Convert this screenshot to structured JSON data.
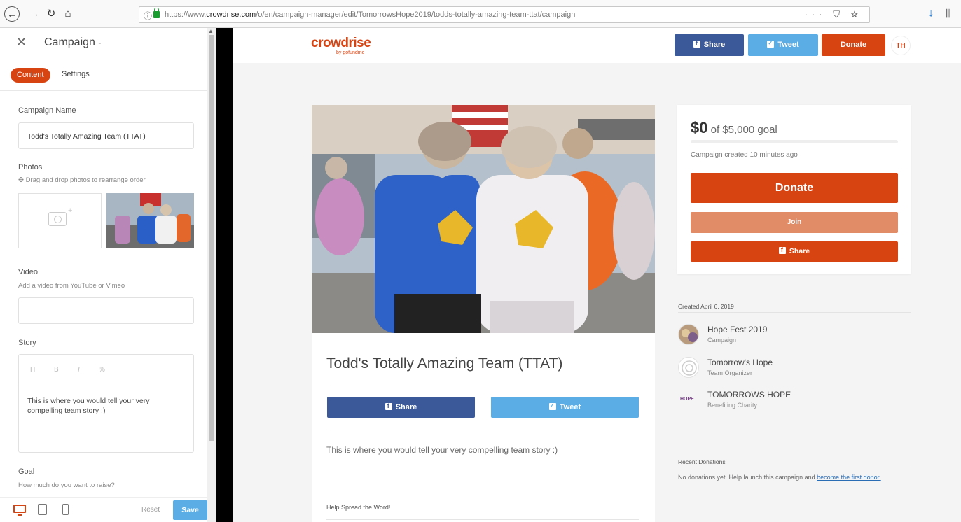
{
  "browser": {
    "url_prefix": "https://www.",
    "url_domain": "crowdrise.com",
    "url_path": "/o/en/campaign-manager/edit/TomorrowsHope2019/todds-totally-amazing-team-ttat/campaign",
    "more_label": "···"
  },
  "editor": {
    "title": "Campaign",
    "tabs": {
      "content": "Content",
      "settings": "Settings"
    },
    "campaign_name_label": "Campaign Name",
    "campaign_name_value": "Todd's Totally Amazing Team (TTAT)",
    "photos_label": "Photos",
    "photos_hint": "Drag and drop photos to rearrange order",
    "video_label": "Video",
    "video_hint": "Add a video from YouTube or Vimeo",
    "story_label": "Story",
    "story_tools": [
      "H",
      "B",
      "I",
      "%"
    ],
    "story_text": "This is where you would tell your very compelling team story :)",
    "goal_label": "Goal",
    "goal_hint": "How much do you want to raise?",
    "reset_label": "Reset",
    "save_label": "Save"
  },
  "site": {
    "logo": "crowdrise",
    "logo_sub": "by gofundme",
    "header_buttons": {
      "share": "Share",
      "tweet": "Tweet",
      "donate": "Donate"
    },
    "avatar_initials": "TH",
    "campaign_title": "Todd's Totally Amazing Team (TTAT)",
    "card_share": "Share",
    "card_tweet": "Tweet",
    "story_text": "This is where you would tell your very compelling team story :)",
    "spread_label": "Help Spread the Word!"
  },
  "donation": {
    "raised": "$0",
    "goal_text": "of $5,000 goal",
    "progress": 0,
    "created_ago": "Campaign created 10 minutes ago",
    "donate_label": "Donate",
    "join_label": "Join",
    "share_label": "Share"
  },
  "sidebar": {
    "created_date": "Created April 6, 2019",
    "related": [
      {
        "name": "Hope Fest 2019",
        "role": "Campaign"
      },
      {
        "name": "Tomorrow's Hope",
        "role": "Team Organizer"
      },
      {
        "name": "TOMORROWS HOPE",
        "role": "Benefiting Charity",
        "logo_text": "HOPE"
      }
    ],
    "recent_label": "Recent Donations",
    "no_donations_text": "No donations yet. Help launch this campaign and ",
    "first_donor_link": "become the first donor."
  },
  "colors": {
    "brand": "#d84312",
    "facebook": "#3b5998",
    "twitter": "#5aaee5"
  }
}
